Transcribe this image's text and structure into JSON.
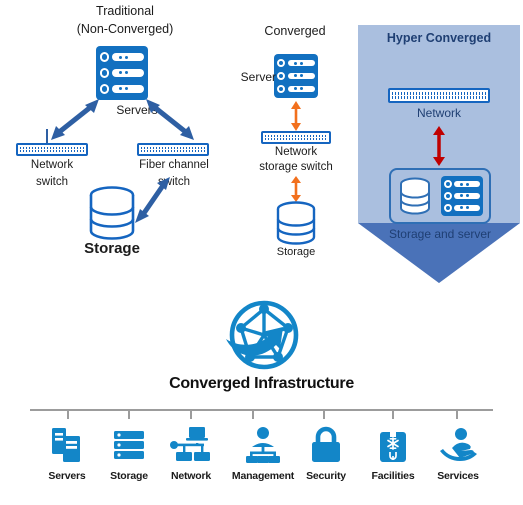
{
  "palette": {
    "server_blue": "#1270c0",
    "outline_blue": "#1565c0",
    "arrow_blue": "#2e5fa3",
    "arrow_orange": "#f2701d",
    "arrow_red": "#c00000",
    "hc_body": "#aabfdf",
    "hc_tip": "#4a72b8",
    "hc_text": "#1f3f73",
    "logo_blue": "#1386c8",
    "rule_gray": "#9c9c9c",
    "bg": "#ffffff"
  },
  "sections": {
    "traditional": {
      "title_line1": "Traditional",
      "title_line2": "(Non-Converged)",
      "servers_label": "Servers",
      "network_switch_label_line1": "Network",
      "network_switch_label_line2": "switch",
      "fiber_switch_label_line1": "Fiber channel",
      "fiber_switch_label_line2": "switch",
      "storage_label": "Storage"
    },
    "converged": {
      "title": "Converged",
      "server_label": "Server",
      "switch_label_line1": "Network",
      "switch_label_line2": "storage switch",
      "storage_label": "Storage"
    },
    "hyper_converged": {
      "title": "Hyper Converged",
      "network_label": "Network",
      "storage_server_label": "Storage and server"
    }
  },
  "footer": {
    "title": "Converged Infrastructure",
    "logo_name": "converged-network-globe-logo",
    "categories": [
      {
        "label": "Servers",
        "icon": "servers-icon"
      },
      {
        "label": "Storage",
        "icon": "storage-icon"
      },
      {
        "label": "Network",
        "icon": "network-icon"
      },
      {
        "label": "Management",
        "icon": "management-icon"
      },
      {
        "label": "Security",
        "icon": "security-lock-icon"
      },
      {
        "label": "Facilities",
        "icon": "facilities-icon"
      },
      {
        "label": "Services",
        "icon": "services-hand-icon"
      }
    ]
  }
}
